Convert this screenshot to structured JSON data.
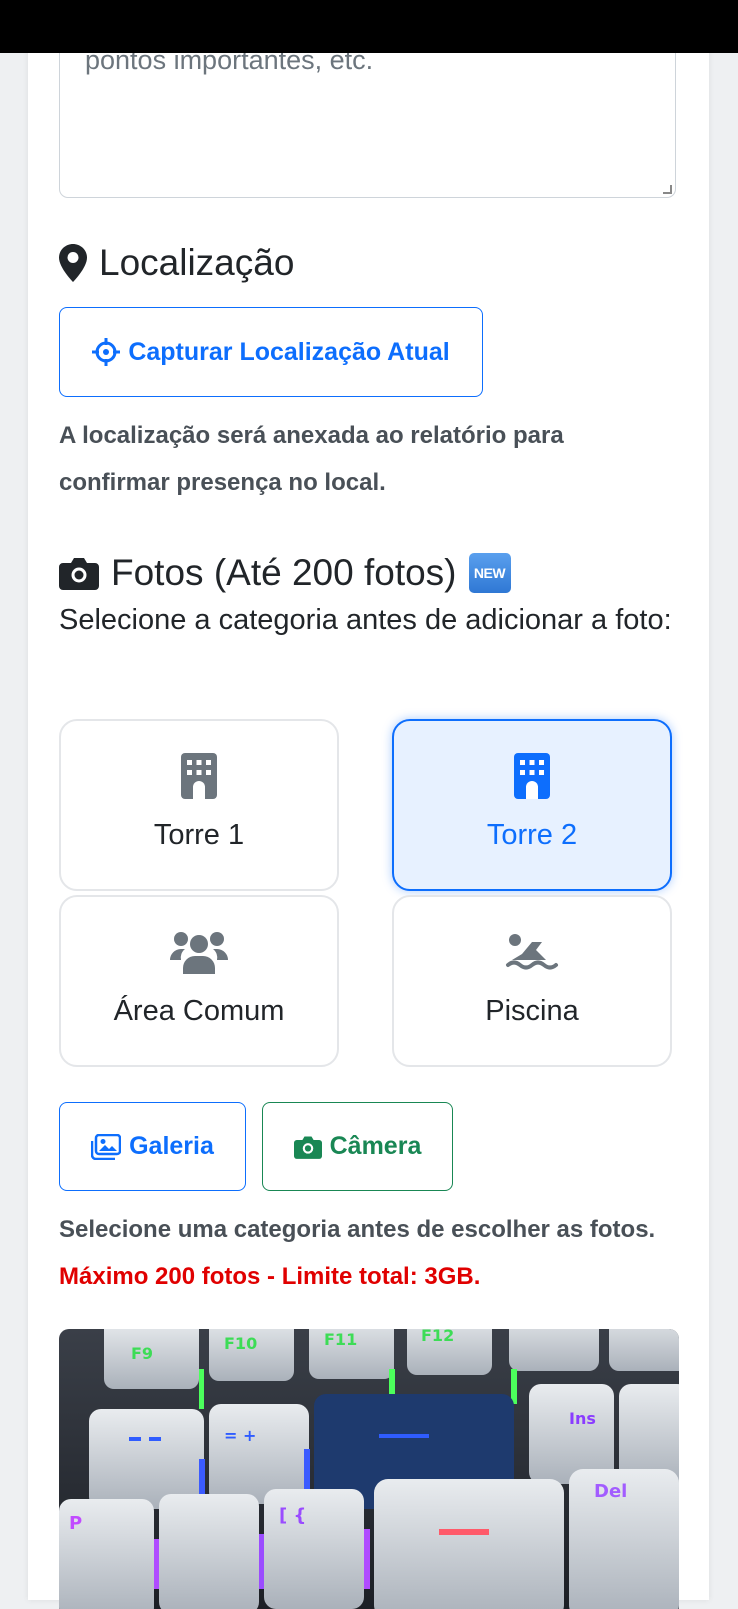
{
  "description_field": {
    "visible_text": "pontos importantes, etc."
  },
  "location": {
    "title": "Localização",
    "capture_button": "Capturar Localização Atual",
    "help_text": "A localização será anexada ao relatório para confirmar presença no local."
  },
  "photos": {
    "title": "Fotos (Até 200 fotos)",
    "new_badge": "NEW",
    "instruction": "Selecione a categoria antes de adicionar a foto:",
    "categories": [
      {
        "label": "Torre 1",
        "icon": "building-icon",
        "selected": false
      },
      {
        "label": "Torre 2",
        "icon": "building-icon",
        "selected": true
      },
      {
        "label": "Área Comum",
        "icon": "users-icon",
        "selected": false
      },
      {
        "label": "Piscina",
        "icon": "swimmer-icon",
        "selected": false
      }
    ],
    "gallery_button": "Galeria",
    "camera_button": "Câmera",
    "help_text": "Selecione uma categoria antes de escolher as fotos.",
    "limit_text": "Máximo 200 fotos - Limite total: 3GB.",
    "keycaps": {
      "f9": "F9",
      "f10": "F10",
      "f11": "F11",
      "f12": "F12",
      "ins": "Ins",
      "del": "Del"
    }
  },
  "colors": {
    "primary": "#0d6efd",
    "success": "#198754",
    "danger": "#e00000",
    "muted_icon": "#6c757d"
  }
}
